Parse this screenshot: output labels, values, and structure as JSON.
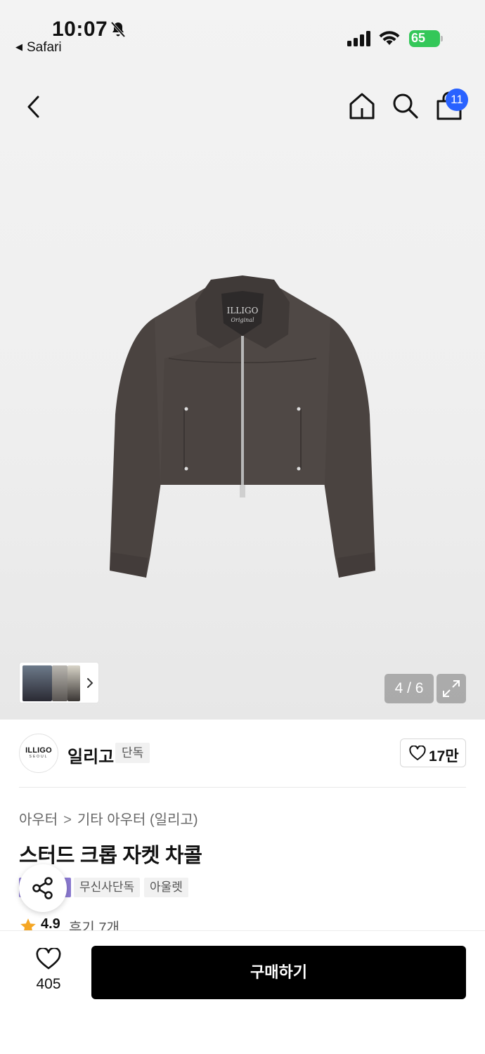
{
  "status_bar": {
    "time": "10:07",
    "back_app": "Safari",
    "battery": "65"
  },
  "nav": {
    "cart_count": "11"
  },
  "gallery": {
    "counter": "4 / 6"
  },
  "brand": {
    "logo_text": "ILLIGO",
    "logo_subtext": "SEOUL",
    "name": "일리고",
    "tag": "단독",
    "like_count": "17만"
  },
  "product": {
    "breadcrumb": [
      "아우터",
      "기타 아우터 (일리고)"
    ],
    "title": "스터드 크롭 자켓 차콜",
    "tags": [
      "무신사단독",
      "아울렛"
    ],
    "rating": "4.9",
    "review_label": "후기 7개"
  },
  "bottom_bar": {
    "wish_count": "405",
    "buy_label": "구매하기"
  },
  "colors": {
    "accent_badge": "#2962ff",
    "buy_button": "#000000",
    "rating_star": "#f5a623",
    "purple_tag": "#8a79d0",
    "jacket": "#4a4340"
  },
  "icons": [
    "back-chevron-icon",
    "home-icon",
    "search-icon",
    "shopping-bag-icon",
    "heart-icon",
    "share-icon",
    "star-icon",
    "expand-icon",
    "bell-slash-icon"
  ]
}
